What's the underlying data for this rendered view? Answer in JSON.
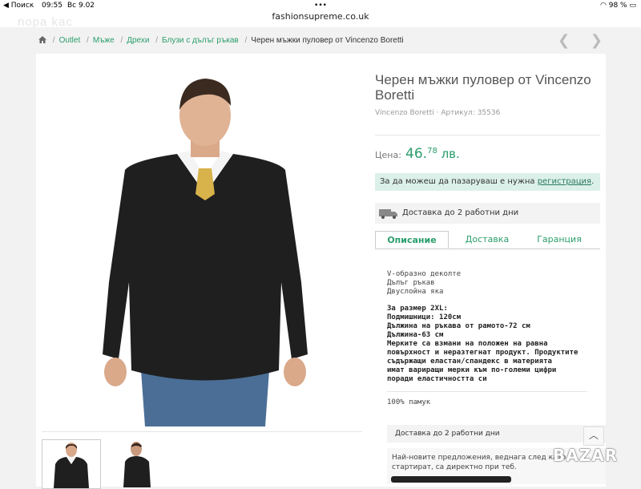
{
  "status_bar": {
    "back_app": "◀ Поиск",
    "time": "09:55",
    "date": "Вс 9.02",
    "battery": "98 %"
  },
  "browser": {
    "url": "fashionsupreme.co.uk",
    "ghost_logo": "nopa kac"
  },
  "breadcrumb": {
    "items": [
      "Outlet",
      "Мъже",
      "Дрехи",
      "Блузи с дълъг ръкав"
    ],
    "current": "Черен мъжки пуловер от Vincenzo Boretti"
  },
  "nav": {
    "prev": "❮",
    "next": "❯"
  },
  "product": {
    "title": "Черен мъжки пуловер от Vincenzo Boretti",
    "brand": "Vincenzo Boretti",
    "meta_sep": " · Артикул: ",
    "sku": "35536",
    "price_label": "Цена:",
    "price_int": "46.",
    "price_dec": "78",
    "currency": " лв.",
    "notice_text": "За да можеш да пазаруваш е нужна ",
    "notice_link": "регистрация",
    "notice_end": ".",
    "delivery": "Доставка до 2 работни дни"
  },
  "tabs": [
    "Описание",
    "Доставка",
    "Гаранция"
  ],
  "description": {
    "features": [
      "V-образно деколте",
      "Дълъг ръкав",
      "Двуслойна яка"
    ],
    "size_title": "За размер 2XL:",
    "size_lines": [
      "Подмишници: 120см",
      "Дължина на ръкава от рамото-72 см",
      "Дължина-63 см",
      "Мерките са взмани на положен на равна",
      "повърхност и неразтегнат продукт. Продуктите",
      "съдържащи еластан/спандекс в материята",
      "имат вариращи мерки към по-големи цифри",
      "поради еластичността си"
    ],
    "material": "100% памук"
  },
  "accordion": {
    "delivery": "Доставка до 2 работни дни",
    "up": "︿"
  },
  "promo": {
    "line1": "Най-новите предложения, веднага след като",
    "line2": "стартират, са директно при теб."
  },
  "watermark": "BAZAR"
}
